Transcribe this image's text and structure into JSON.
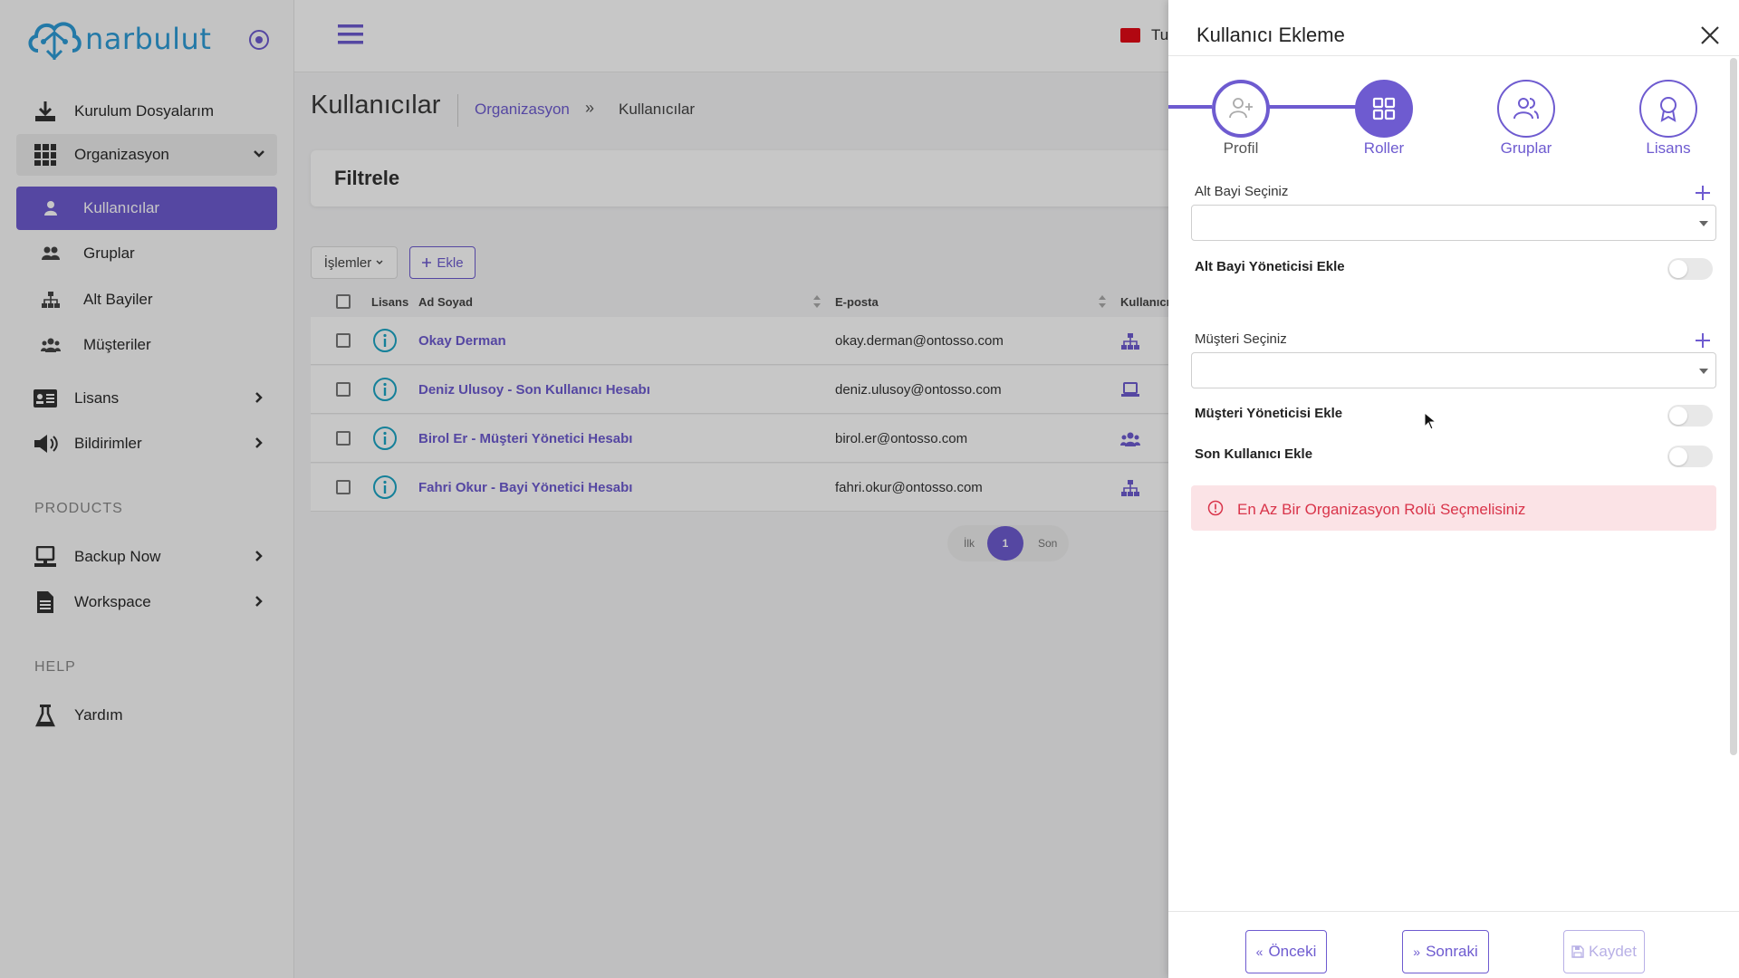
{
  "brand": {
    "name": "narbulut"
  },
  "sidebar": {
    "items": [
      {
        "label": "Kurulum Dosyalarım",
        "icon": "download-icon"
      },
      {
        "label": "Organizasyon",
        "icon": "grid-icon"
      },
      {
        "label": "Kullanıcılar",
        "icon": "user-icon"
      },
      {
        "label": "Gruplar",
        "icon": "users-icon"
      },
      {
        "label": "Alt Bayiler",
        "icon": "sitemap-icon"
      },
      {
        "label": "Müşteriler",
        "icon": "customers-icon"
      },
      {
        "label": "Lisans",
        "icon": "id-card-icon"
      },
      {
        "label": "Bildirimler",
        "icon": "megaphone-icon"
      },
      {
        "label": "Backup Now",
        "icon": "server-icon"
      },
      {
        "label": "Workspace",
        "icon": "document-icon"
      },
      {
        "label": "Yardım",
        "icon": "flask-icon"
      }
    ],
    "sections": {
      "products": "PRODUCTS",
      "help": "HELP"
    }
  },
  "topbar": {
    "language": "Tu"
  },
  "page": {
    "title": "Kullanıcılar",
    "breadcrumb": {
      "parent": "Organizasyon",
      "separator": "»",
      "current": "Kullanıcılar"
    },
    "filter_title": "Filtrele",
    "actions": {
      "islemler": "İşlemler",
      "ekle": "Ekle"
    }
  },
  "table": {
    "headers": {
      "lisans": "Lisans",
      "name": "Ad Soyad",
      "email": "E-posta",
      "type": "Kullanıcı"
    },
    "rows": [
      {
        "name": "Okay Derman",
        "email": "okay.derman@ontosso.com",
        "type_icon": "sitemap-icon"
      },
      {
        "name": "Deniz Ulusoy - Son Kullanıcı Hesabı",
        "email": "deniz.ulusoy@ontosso.com",
        "type_icon": "laptop-icon"
      },
      {
        "name": "Birol Er - Müşteri Yönetici Hesabı",
        "email": "birol.er@ontosso.com",
        "type_icon": "users-icon"
      },
      {
        "name": "Fahri Okur - Bayi Yönetici Hesabı",
        "email": "fahri.okur@ontosso.com",
        "type_icon": "sitemap-icon"
      }
    ]
  },
  "pagination": {
    "first": "İlk",
    "current": "1",
    "last": "Son"
  },
  "panel": {
    "title": "Kullanıcı Ekleme",
    "steps": [
      {
        "label": "Profil",
        "state": "done"
      },
      {
        "label": "Roller",
        "state": "active"
      },
      {
        "label": "Gruplar",
        "state": "pending"
      },
      {
        "label": "Lisans",
        "state": "pending"
      }
    ],
    "alt_bayi_label": "Alt Bayi Seçiniz",
    "alt_bayi_value": "",
    "alt_bayi_admin_label": "Alt Bayi Yöneticisi Ekle",
    "musteri_label": "Müşteri Seçiniz",
    "musteri_value": "",
    "musteri_admin_label": "Müşteri Yöneticisi Ekle",
    "end_user_label": "Son Kullanıcı Ekle",
    "toggles": {
      "alt_bayi_admin": false,
      "musteri_admin": false,
      "end_user": false
    },
    "alert": "En Az Bir Organizasyon Rolü Seçmelisiniz",
    "buttons": {
      "prev": "Önceki",
      "next": "Sonraki",
      "save": "Kaydet"
    }
  },
  "colors": {
    "accent": "#6e5bd0",
    "brand": "#2d9bd6",
    "info": "#1aa5c4",
    "alert_text": "#d9344a",
    "alert_bg": "#fbe3e6"
  }
}
